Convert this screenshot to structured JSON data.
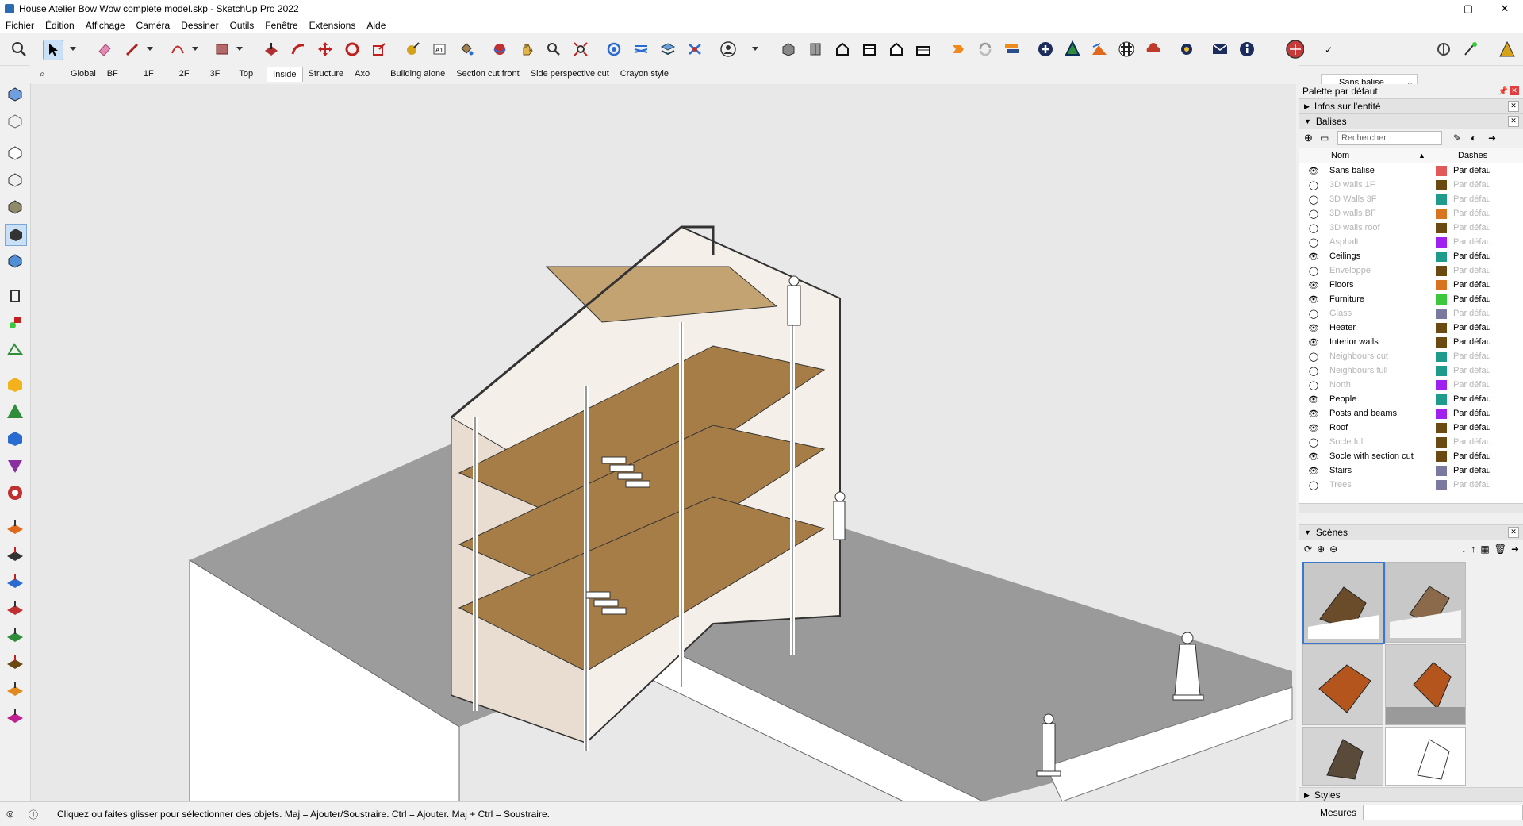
{
  "window": {
    "title": "House Atelier Bow Wow complete model.skp - SketchUp Pro 2022"
  },
  "window_controls": {
    "minimize": "—",
    "maximize": "▢",
    "close": "✕"
  },
  "menu": [
    "Fichier",
    "Édition",
    "Affichage",
    "Caméra",
    "Dessiner",
    "Outils",
    "Fenêtre",
    "Extensions",
    "Aide"
  ],
  "toolbar": {
    "tag_selector": "Sans balise"
  },
  "scene_tabs": [
    "Global",
    "BF",
    "1F",
    "2F",
    "3F",
    "Top",
    "Inside",
    "Structure",
    "Axo",
    "Building alone",
    "Section cut front",
    "Side perspective cut",
    "Crayon style"
  ],
  "active_scene_tab": "Inside",
  "tray": {
    "title": "Palette par défaut",
    "entity_info": "Infos sur l'entité",
    "tags_title": "Balises",
    "search_placeholder": "Rechercher",
    "col_name": "Nom",
    "col_dashes": "Dashes",
    "tags": [
      {
        "name": "Sans balise",
        "visible": true,
        "color": "#e05a5a",
        "dash": "Par défaut"
      },
      {
        "name": "3D walls 1F",
        "visible": false,
        "color": "#6b4a12",
        "dash": "Par défaut"
      },
      {
        "name": "3D Walls 3F",
        "visible": false,
        "color": "#1f9b8b",
        "dash": "Par défaut"
      },
      {
        "name": "3D walls BF",
        "visible": false,
        "color": "#d8741f",
        "dash": "Par défaut"
      },
      {
        "name": "3D walls roof",
        "visible": false,
        "color": "#6b4a12",
        "dash": "Par défaut"
      },
      {
        "name": "Asphalt",
        "visible": false,
        "color": "#a020f0",
        "dash": "Par défaut"
      },
      {
        "name": "Ceilings",
        "visible": true,
        "color": "#1f9b8b",
        "dash": "Par défaut"
      },
      {
        "name": "Enveloppe",
        "visible": false,
        "color": "#6b4a12",
        "dash": "Par défaut"
      },
      {
        "name": "Floors",
        "visible": true,
        "color": "#d8741f",
        "dash": "Par défaut"
      },
      {
        "name": "Furniture",
        "visible": true,
        "color": "#3cc83c",
        "dash": "Par défaut"
      },
      {
        "name": "Glass",
        "visible": false,
        "color": "#7a7aa0",
        "dash": "Par défaut"
      },
      {
        "name": "Heater",
        "visible": true,
        "color": "#6b4a12",
        "dash": "Par défaut"
      },
      {
        "name": "Interior walls",
        "visible": true,
        "color": "#6b4a12",
        "dash": "Par défaut"
      },
      {
        "name": "Neighbours cut",
        "visible": false,
        "color": "#1f9b8b",
        "dash": "Par défaut"
      },
      {
        "name": "Neighbours full",
        "visible": false,
        "color": "#1f9b8b",
        "dash": "Par défaut"
      },
      {
        "name": "North",
        "visible": false,
        "color": "#a020f0",
        "dash": "Par défaut"
      },
      {
        "name": "People",
        "visible": true,
        "color": "#1f9b8b",
        "dash": "Par défaut"
      },
      {
        "name": "Posts and beams",
        "visible": true,
        "color": "#a020f0",
        "dash": "Par défaut"
      },
      {
        "name": "Roof",
        "visible": true,
        "color": "#6b4a12",
        "dash": "Par défaut"
      },
      {
        "name": "Socle full",
        "visible": false,
        "color": "#6b4a12",
        "dash": "Par défaut"
      },
      {
        "name": "Socle with section cut",
        "visible": true,
        "color": "#6b4a12",
        "dash": "Par défaut"
      },
      {
        "name": "Stairs",
        "visible": true,
        "color": "#7a7aa0",
        "dash": "Par défaut"
      },
      {
        "name": "Trees",
        "visible": false,
        "color": "#7a7aa0",
        "dash": "Par défaut"
      }
    ],
    "scenes_title": "Scènes",
    "styles_title": "Styles"
  },
  "status": {
    "message": "Cliquez ou faites glisser pour sélectionner des objets. Maj = Ajouter/Soustraire. Ctrl = Ajouter. Maj + Ctrl = Soustraire.",
    "measures_label": "Mesures"
  }
}
